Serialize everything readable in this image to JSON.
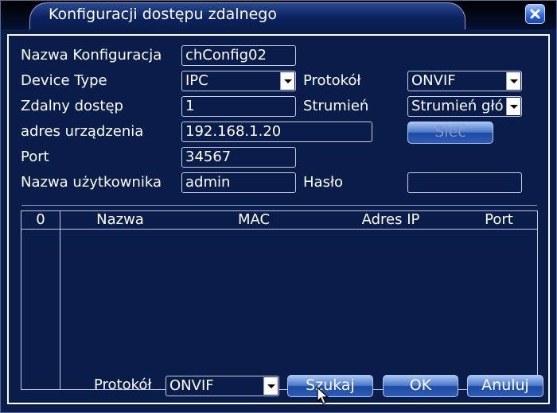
{
  "window": {
    "title": "Konfiguracji dostępu zdalnego"
  },
  "form": {
    "config_name_label": "Nazwa Konfiguracja",
    "config_name_value": "chConfig02",
    "device_type_label": "Device Type",
    "device_type_value": "IPC",
    "protocol_label": "Protokół",
    "protocol_value": "ONVIF",
    "remote_channel_label": "Zdalny dostęp",
    "remote_channel_value": "1",
    "stream_label": "Strumień",
    "stream_value": "Strumień głó",
    "device_address_label": "adres urządzenia",
    "device_address_value": "192.168.1.20",
    "network_button": "Sieć",
    "port_label": "Port",
    "port_value": "34567",
    "username_label": "Nazwa użytkownika",
    "username_value": "admin",
    "password_label": "Hasło",
    "password_value": ""
  },
  "table": {
    "columns": [
      "0",
      "Nazwa",
      "MAC",
      "Adres IP",
      "Port"
    ],
    "rows": []
  },
  "footer": {
    "protocol_label": "Protokół",
    "protocol_value": "ONVIF",
    "search_button": "Szukaj",
    "ok_button": "OK",
    "cancel_button": "Anuluj"
  },
  "colors": {
    "background": "#0a1d4a",
    "button_gradient_top": "#a8c4f4",
    "button_gradient_bottom": "#1f4aa0",
    "close_button": "#2c66d8"
  },
  "icons": {
    "close": "close-icon",
    "dropdown": "chevron-down-icon",
    "cursor": "mouse-pointer-icon"
  }
}
